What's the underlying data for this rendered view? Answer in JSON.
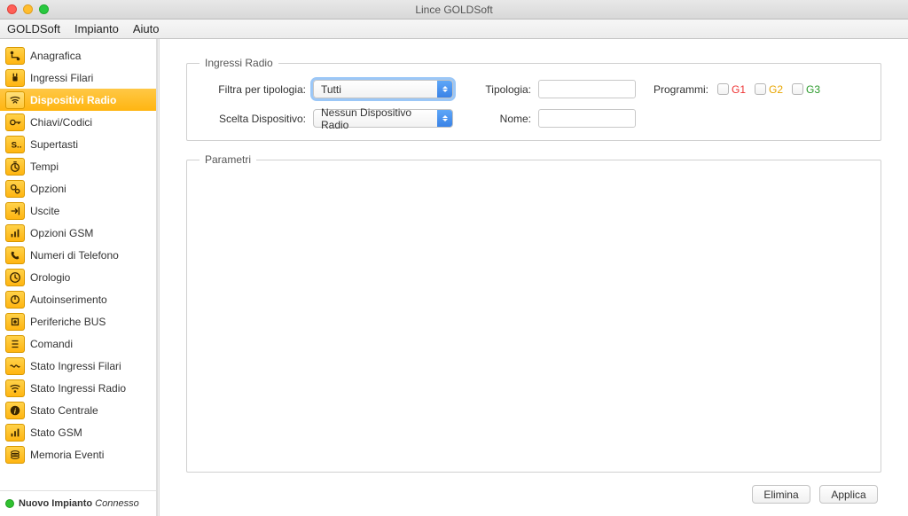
{
  "window": {
    "title": "Lince GOLDSoft"
  },
  "menu": {
    "items": [
      "GOLDSoft",
      "Impianto",
      "Aiuto"
    ]
  },
  "sidebar": {
    "items": [
      {
        "label": "Anagrafica",
        "icon": "route-icon"
      },
      {
        "label": "Ingressi Filari",
        "icon": "plug-icon"
      },
      {
        "label": "Dispositivi Radio",
        "icon": "wifi-icon",
        "selected": true
      },
      {
        "label": "Chiavi/Codici",
        "icon": "key-icon"
      },
      {
        "label": "Supertasti",
        "icon": "s-icon"
      },
      {
        "label": "Tempi",
        "icon": "stopwatch-icon"
      },
      {
        "label": "Opzioni",
        "icon": "gears-icon"
      },
      {
        "label": "Uscite",
        "icon": "arrow-out-icon"
      },
      {
        "label": "Opzioni GSM",
        "icon": "antenna-icon"
      },
      {
        "label": "Numeri di Telefono",
        "icon": "phone-icon"
      },
      {
        "label": "Orologio",
        "icon": "clock-icon"
      },
      {
        "label": "Autoinserimento",
        "icon": "power-icon"
      },
      {
        "label": "Periferiche BUS",
        "icon": "chip-icon"
      },
      {
        "label": "Comandi",
        "icon": "list-icon"
      },
      {
        "label": "Stato Ingressi Filari",
        "icon": "wave-plug-icon"
      },
      {
        "label": "Stato Ingressi Radio",
        "icon": "wave-wifi-icon"
      },
      {
        "label": "Stato Centrale",
        "icon": "info-icon"
      },
      {
        "label": "Stato GSM",
        "icon": "wave-antenna-icon"
      },
      {
        "label": "Memoria Eventi",
        "icon": "stack-icon"
      }
    ],
    "status": {
      "strong": "Nuovo Impianto",
      "italic": "Connesso"
    }
  },
  "panel": {
    "ingressi": {
      "legend": "Ingressi Radio",
      "filter_label": "Filtra per tipologia:",
      "filter_value": "Tutti",
      "tipologia_label": "Tipologia:",
      "tipologia_value": "",
      "programmi_label": "Programmi:",
      "g1": "G1",
      "g2": "G2",
      "g3": "G3",
      "device_label": "Scelta Dispositivo:",
      "device_value": "Nessun Dispositivo Radio",
      "nome_label": "Nome:",
      "nome_value": ""
    },
    "parametri": {
      "legend": "Parametri"
    },
    "buttons": {
      "elimina": "Elimina",
      "applica": "Applica"
    }
  }
}
